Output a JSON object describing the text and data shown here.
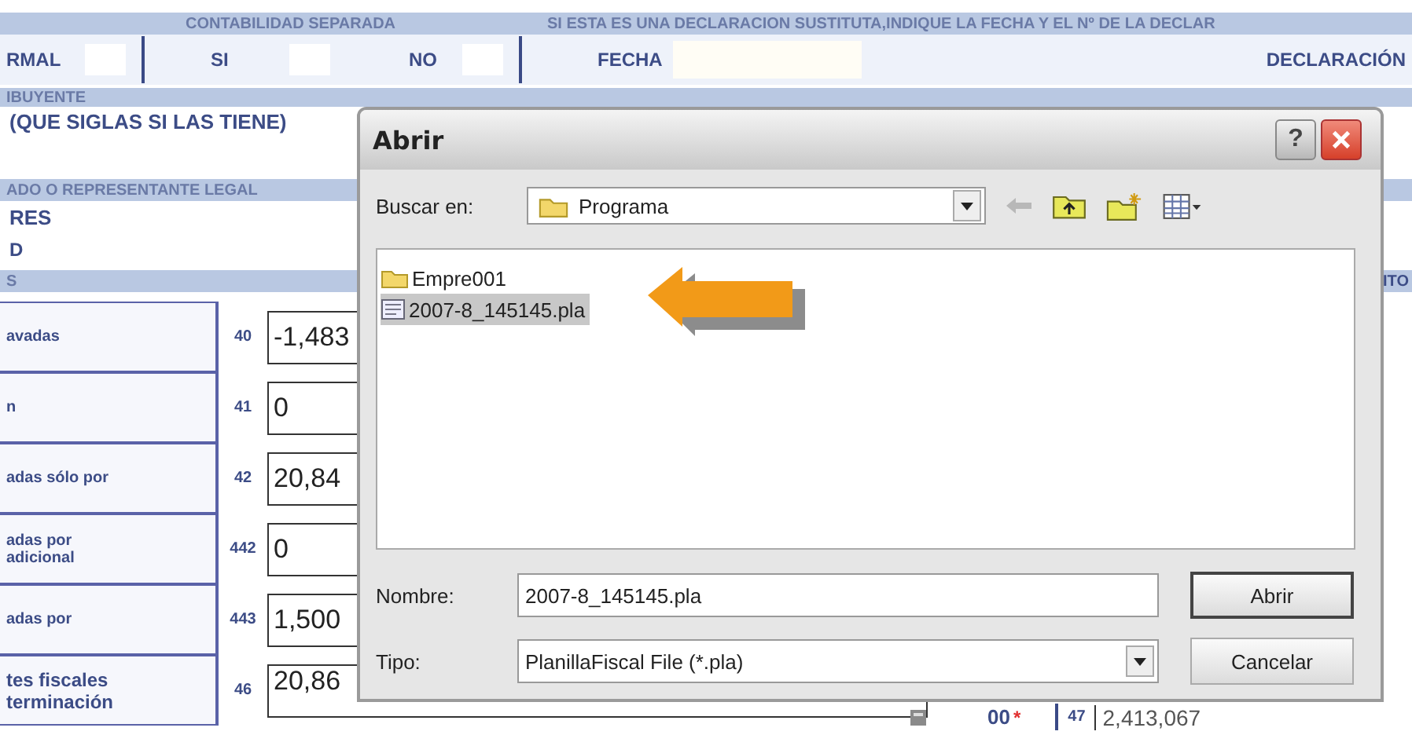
{
  "form": {
    "header": {
      "contabilidad": "CONTABILIDAD SEPARADA",
      "sustituta": "SI ESTA ES UNA DECLARACION SUSTITUTA,INDIQUE LA FECHA Y EL Nº DE LA DECLAR"
    },
    "top_row": {
      "type_label": "RMAL",
      "si": "SI",
      "no": "NO",
      "fecha": "FECHA",
      "declaracion": "DECLARACIÓN"
    },
    "contributor": {
      "band": "IBUYENTE",
      "hint": "(QUE SIGLAS SI LAS TIENE)"
    },
    "representative": {
      "band": "ADO O REPRESENTANTE LEGAL",
      "line_1": "RES",
      "line_2": "D"
    },
    "section_band": "S",
    "right_heading": "ITO",
    "rows": [
      {
        "label": "avadas",
        "code": "40",
        "value": "-1,483"
      },
      {
        "label": "n",
        "code": "41",
        "value": "0"
      },
      {
        "label": "adas sólo por",
        "code": "42",
        "value": "20,84"
      },
      {
        "label": "adas por\nadicional",
        "code": "442",
        "value": "0"
      },
      {
        "label": "adas por",
        "code": "443",
        "value": "1,500"
      },
      {
        "label": "tes fiscales\nterminación",
        "code": "46",
        "value": "20,86"
      }
    ],
    "bottom_right": {
      "cents": "00",
      "required_mark": "*",
      "code": "47",
      "value": "2,413,067"
    }
  },
  "dialog": {
    "title": "Abrir",
    "help_button": "?",
    "look_in_label": "Buscar en:",
    "look_in": "Programa",
    "files": [
      {
        "name": "Empre001",
        "kind": "folder",
        "selected": false
      },
      {
        "name": "2007-8_145145.pla",
        "kind": "file",
        "selected": true
      }
    ],
    "file_name_label": "Nombre:",
    "file_name": "2007-8_145145.pla",
    "file_type_label": "Tipo:",
    "file_type": "PlanillaFiscal File (*.pla)",
    "open_button": "Abrir",
    "cancel_button": "Cancelar"
  }
}
